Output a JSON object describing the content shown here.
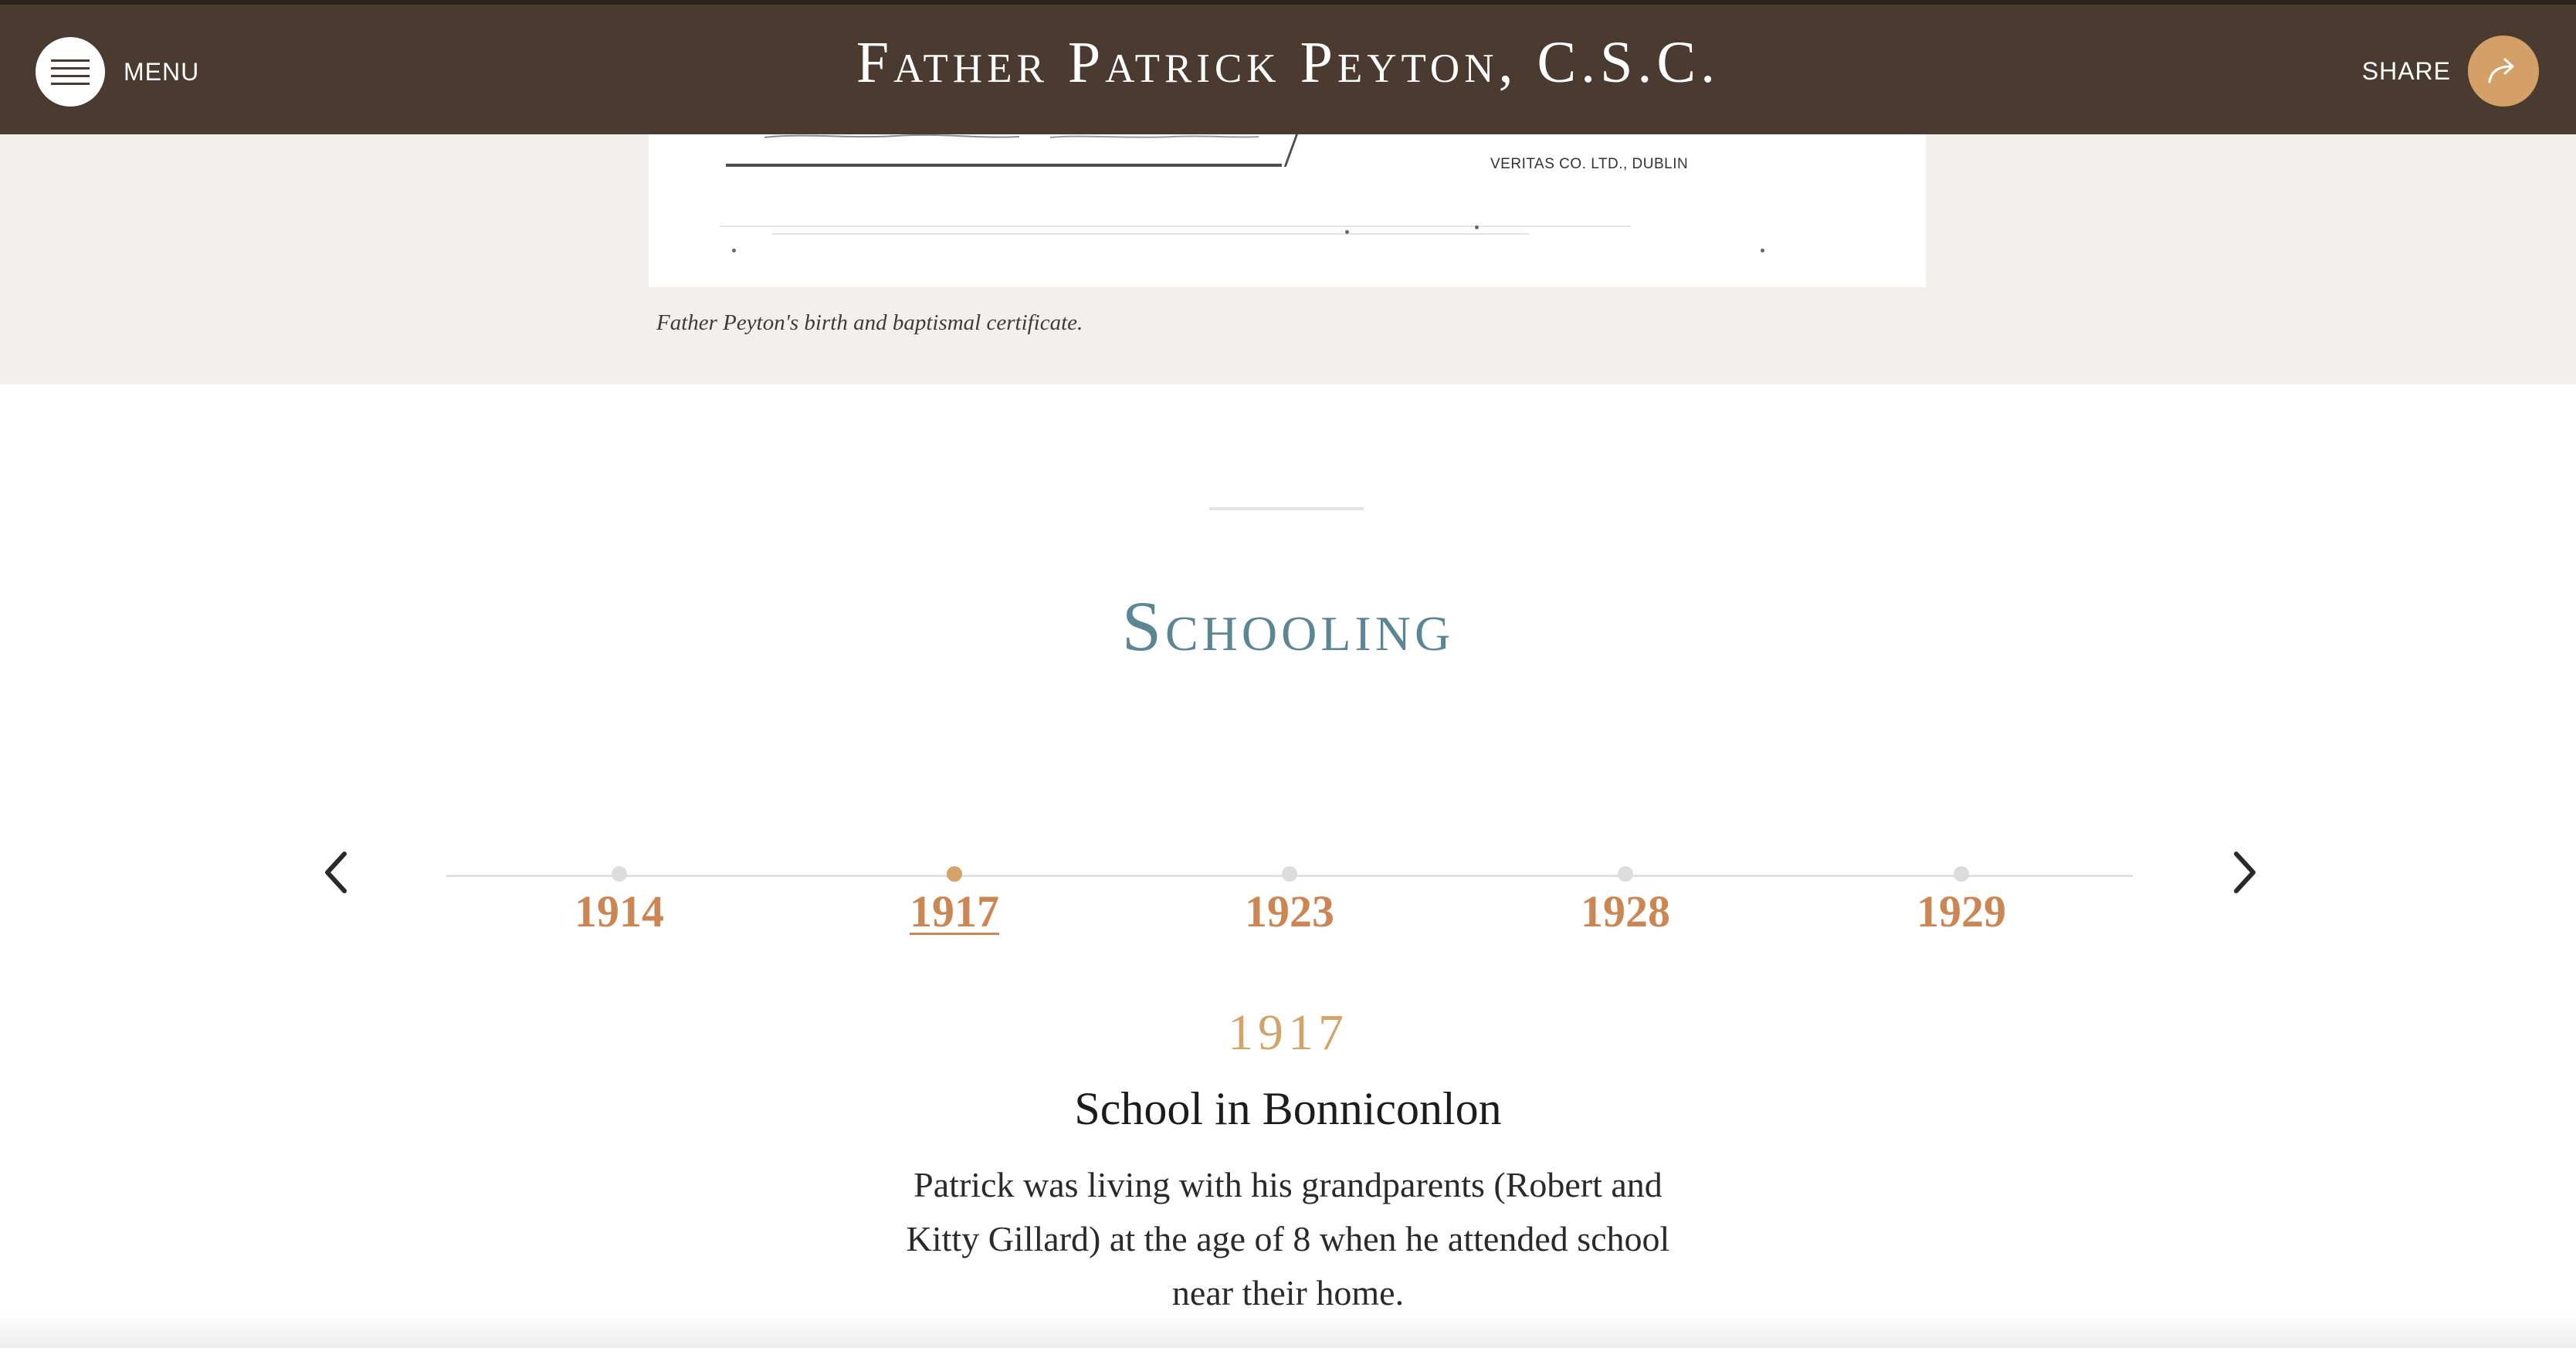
{
  "header": {
    "menu_label": "MENU",
    "title": "Father Patrick Peyton, C.S.C.",
    "share_label": "SHARE",
    "share_accent": "#d4a068",
    "background": "#4a3a30",
    "menu_icon": "hamburger-icon",
    "share_icon": "share-arrow-icon"
  },
  "certificate": {
    "printer_text": "VERITAS CO. LTD., DUBLIN",
    "caption": "Father Peyton's birth and baptismal certificate."
  },
  "section": {
    "title": "Schooling",
    "title_color": "#5d8694"
  },
  "timeline": {
    "prev_icon": "chevron-left-icon",
    "next_icon": "chevron-right-icon",
    "years": [
      "1914",
      "1917",
      "1923",
      "1928",
      "1929"
    ],
    "active_year": "1917",
    "year_color": "#cc8654"
  },
  "event": {
    "year": "1917",
    "title": "School in Bonniconlon",
    "body": "Patrick was living with his grandparents (Robert and Kitty Gillard) at the age of 8 when he attended school near their home."
  }
}
